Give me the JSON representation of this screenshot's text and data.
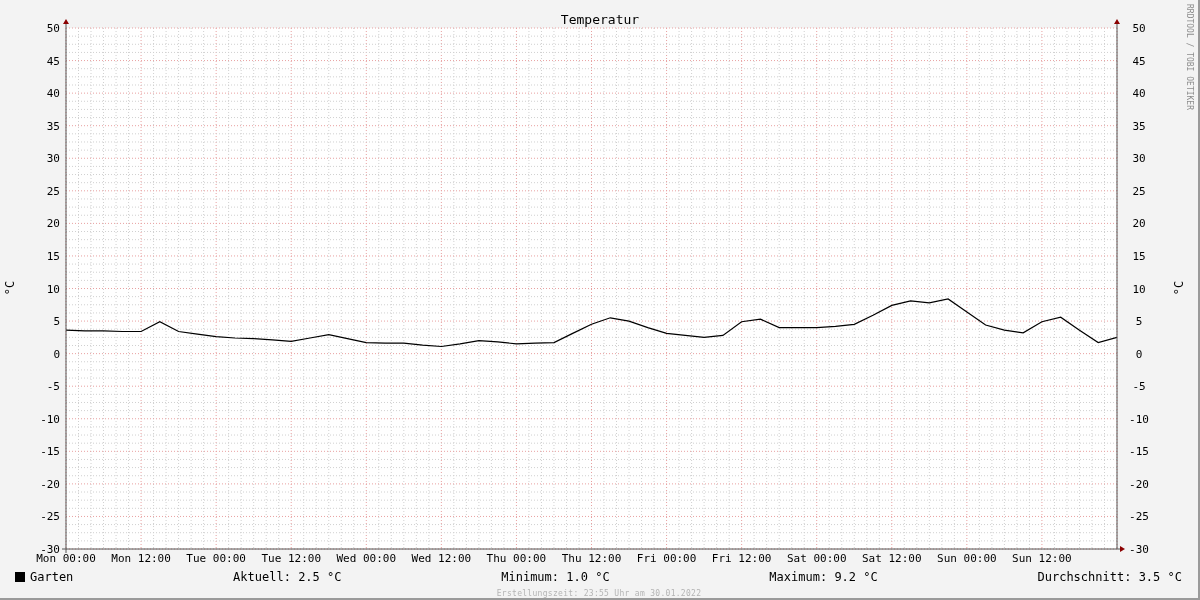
{
  "graph": {
    "watermark": "RRDTOOL / TOBI OETIKER",
    "right_axis_label": "°C",
    "right_yticks": [
      "50",
      "45",
      "40",
      "35",
      "30",
      "25",
      "20",
      "15",
      "10",
      "5",
      "0",
      "-5",
      "-10",
      "-15",
      "-20",
      "-25",
      "-30"
    ],
    "chart_data": {
      "type": "line",
      "grid": true,
      "title": "Temperatur",
      "ylabel": "°C",
      "ylim": [
        -30,
        50
      ],
      "yticks": [
        -30,
        -25,
        -20,
        -15,
        -10,
        -5,
        0,
        5,
        10,
        15,
        20,
        25,
        30,
        35,
        40,
        45,
        50
      ],
      "categories": [
        "Mon 00:00",
        null,
        null,
        null,
        "Mon 12:00",
        null,
        null,
        null,
        "Tue 00:00",
        null,
        null,
        null,
        "Tue 12:00",
        null,
        null,
        null,
        "Wed 00:00",
        null,
        null,
        null,
        "Wed 12:00",
        null,
        null,
        null,
        "Thu 00:00",
        null,
        null,
        null,
        "Thu 12:00",
        null,
        null,
        null,
        "Fri 00:00",
        null,
        null,
        null,
        "Fri 12:00",
        null,
        null,
        null,
        "Sat 00:00",
        null,
        null,
        null,
        "Sat 12:00",
        null,
        null,
        null,
        "Sun 00:00",
        null,
        null,
        null,
        "Sun 12:00",
        null,
        null,
        null,
        null
      ],
      "series": [
        {
          "name": "Garten",
          "color": "#000000",
          "values": [
            3.6,
            3.5,
            3.5,
            3.4,
            3.4,
            4.9,
            3.4,
            3.0,
            2.6,
            2.4,
            2.3,
            2.1,
            1.9,
            2.4,
            2.9,
            2.3,
            1.7,
            1.6,
            1.6,
            1.3,
            1.1,
            1.5,
            2.0,
            1.8,
            1.5,
            1.6,
            1.7,
            3.1,
            4.5,
            5.5,
            5.0,
            4.0,
            3.1,
            2.8,
            2.5,
            2.8,
            4.9,
            5.3,
            4.0,
            4.0,
            4.0,
            4.2,
            4.5,
            5.9,
            7.4,
            8.1,
            7.8,
            8.4,
            6.4,
            4.4,
            3.6,
            3.2,
            4.9,
            5.6,
            3.6,
            1.7,
            2.5
          ]
        }
      ]
    }
  },
  "legend": {
    "stats": [
      "Aktuell: 2.5 °C",
      "Minimum: 1.0 °C",
      "Maximum: 9.2 °C",
      "Durchschnitt: 3.5 °C"
    ]
  },
  "footer": "Erstellungszeit: 23:55 Uhr am 30.01.2022"
}
